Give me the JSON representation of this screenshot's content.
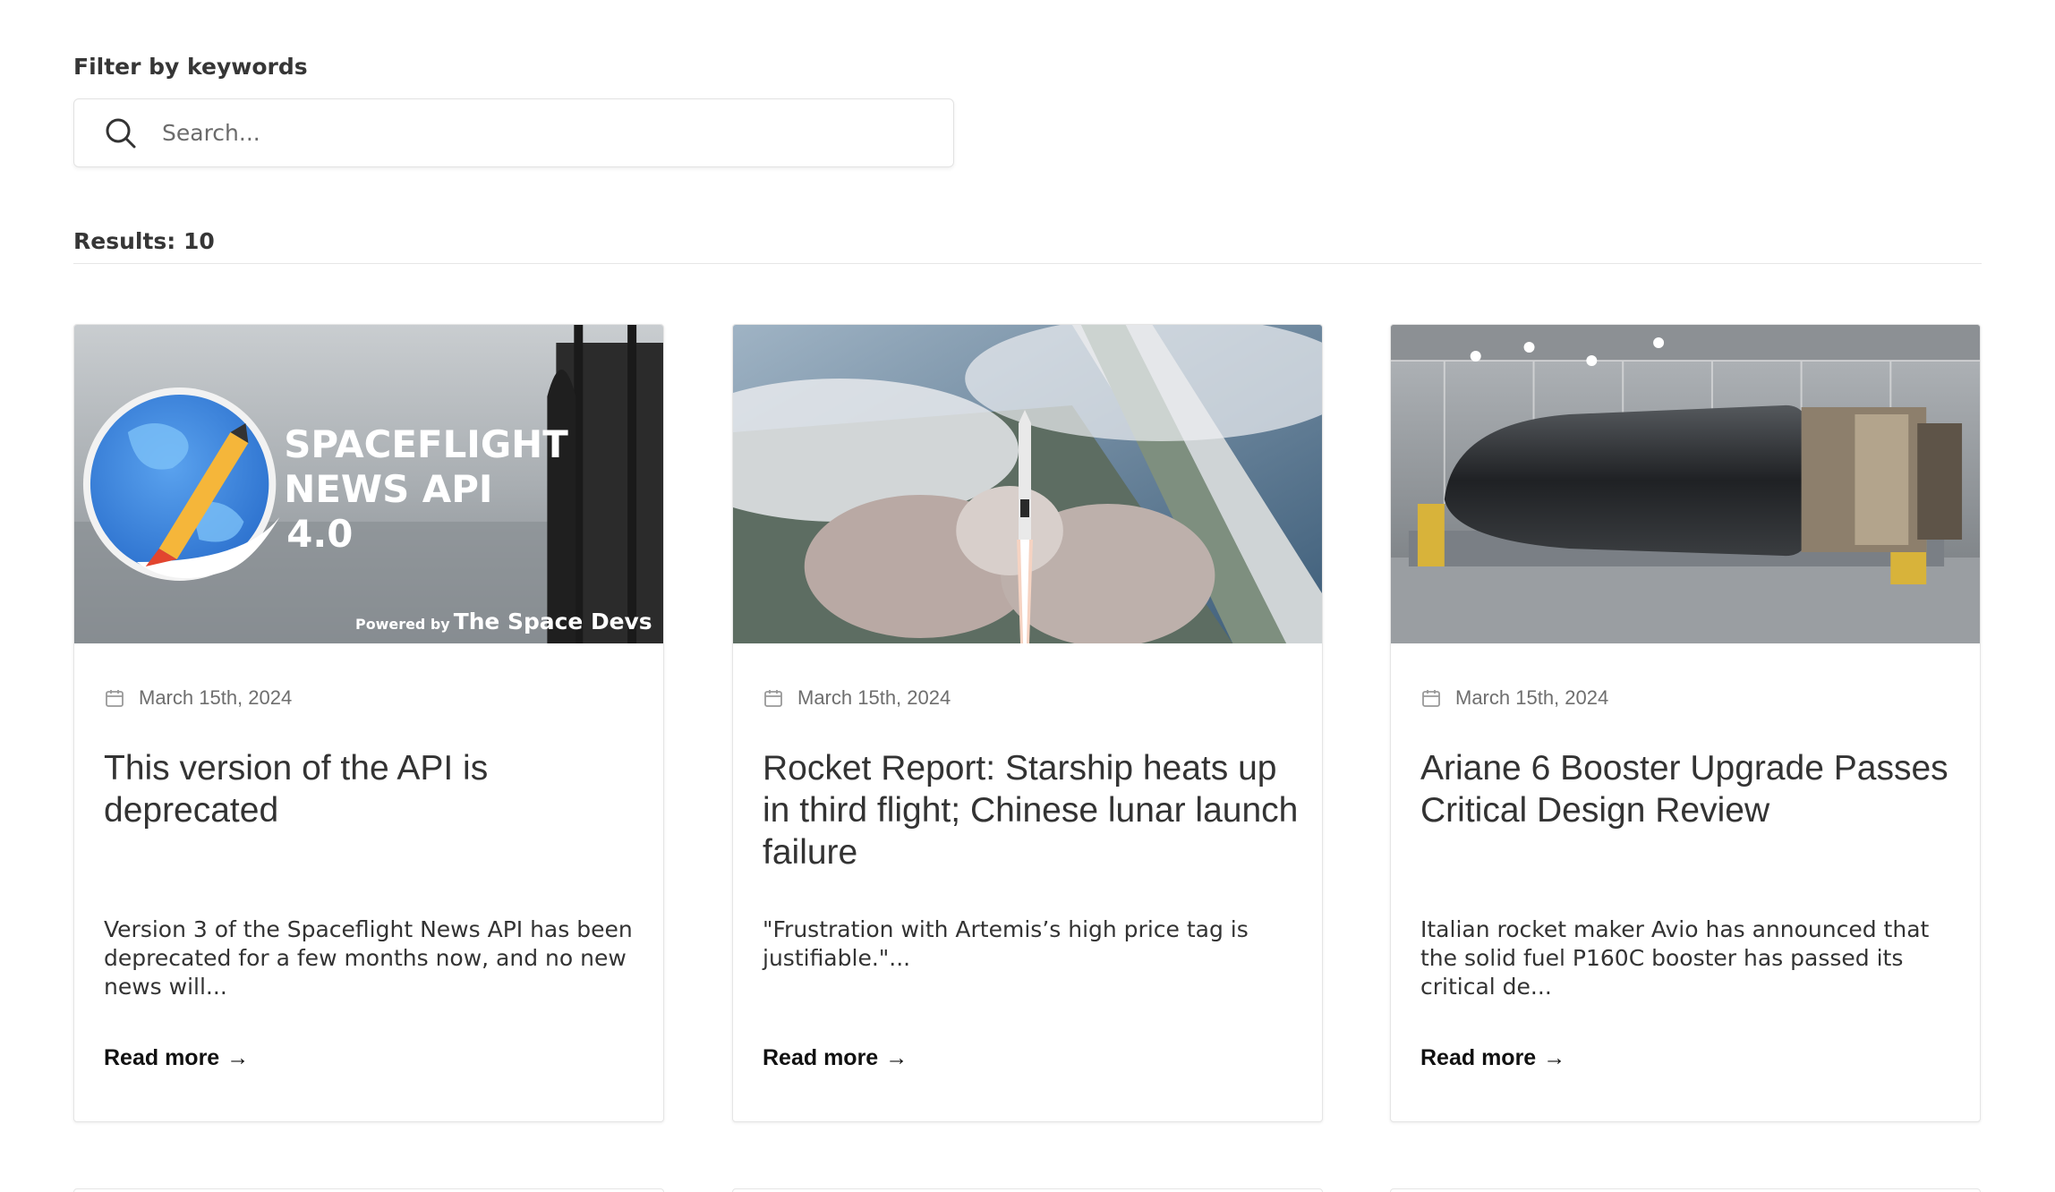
{
  "filter": {
    "label": "Filter by keywords",
    "search_placeholder": "Search..."
  },
  "results": {
    "label": "Results: 10"
  },
  "icons": {
    "search": "search-icon",
    "calendar": "calendar-icon",
    "arrow": "arrow-right-icon"
  },
  "articles": [
    {
      "date": "March 15th, 2024",
      "title": "This version of the API is deprecated",
      "summary": "Version 3 of the Spaceflight News API has been deprecated for a few months now, and no new news will...",
      "read_more": "Read more",
      "image_text": {
        "line1": "SPACEFLIGHT",
        "line2": "NEWS API",
        "line3": "4.0",
        "powered_by": "Powered by",
        "brand": "The Space Devs"
      }
    },
    {
      "date": "March 15th, 2024",
      "title": "Rocket Report: Starship heats up in third flight; Chinese lunar launch failure",
      "summary": "\"Frustration with Artemis’s high price tag is justifiable.\"...",
      "read_more": "Read more"
    },
    {
      "date": "March 15th, 2024",
      "title": "Ariane 6 Booster Upgrade Passes Critical Design Review",
      "summary": "Italian rocket maker Avio has announced that the solid fuel P160C booster has passed its critical de...",
      "read_more": "Read more"
    }
  ],
  "arrow_glyph": "→"
}
